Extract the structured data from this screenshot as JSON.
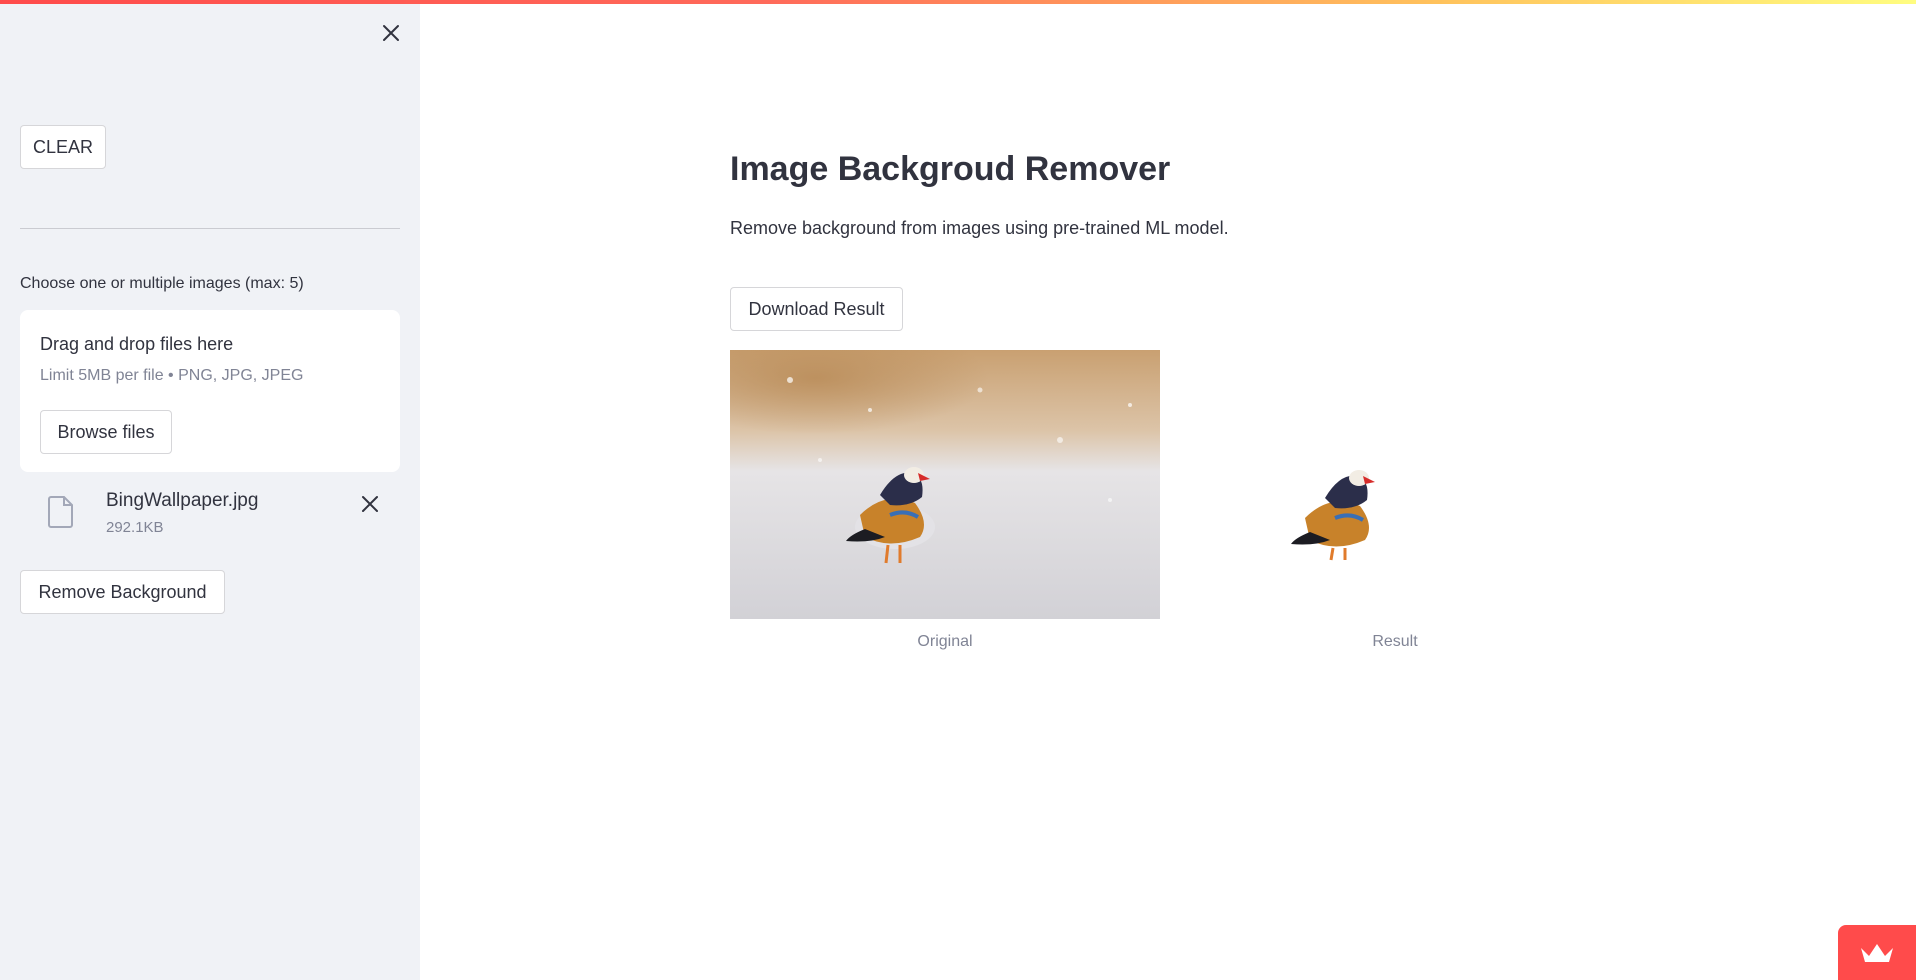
{
  "sidebar": {
    "clear_label": "CLEAR",
    "uploader_label": "Choose one or multiple images (max: 5)",
    "dropzone": {
      "title": "Drag and drop files here",
      "limit": "Limit 5MB per file • PNG, JPG, JPEG",
      "browse_label": "Browse files"
    },
    "file": {
      "name": "BingWallpaper.jpg",
      "size": "292.1KB"
    },
    "remove_bg_label": "Remove Background"
  },
  "main": {
    "title": "Image Backgroud Remover",
    "description": "Remove background from images using pre-trained ML model.",
    "download_label": "Download Result",
    "captions": {
      "original": "Original",
      "result": "Result"
    }
  },
  "icons": {
    "close": "close-icon",
    "file": "file-icon",
    "remove": "close-icon",
    "badge": "crown-icon"
  },
  "colors": {
    "sidebar_bg": "#f0f2f6",
    "accent": "#ff4b4b",
    "text": "#31333f",
    "muted": "#808495"
  }
}
